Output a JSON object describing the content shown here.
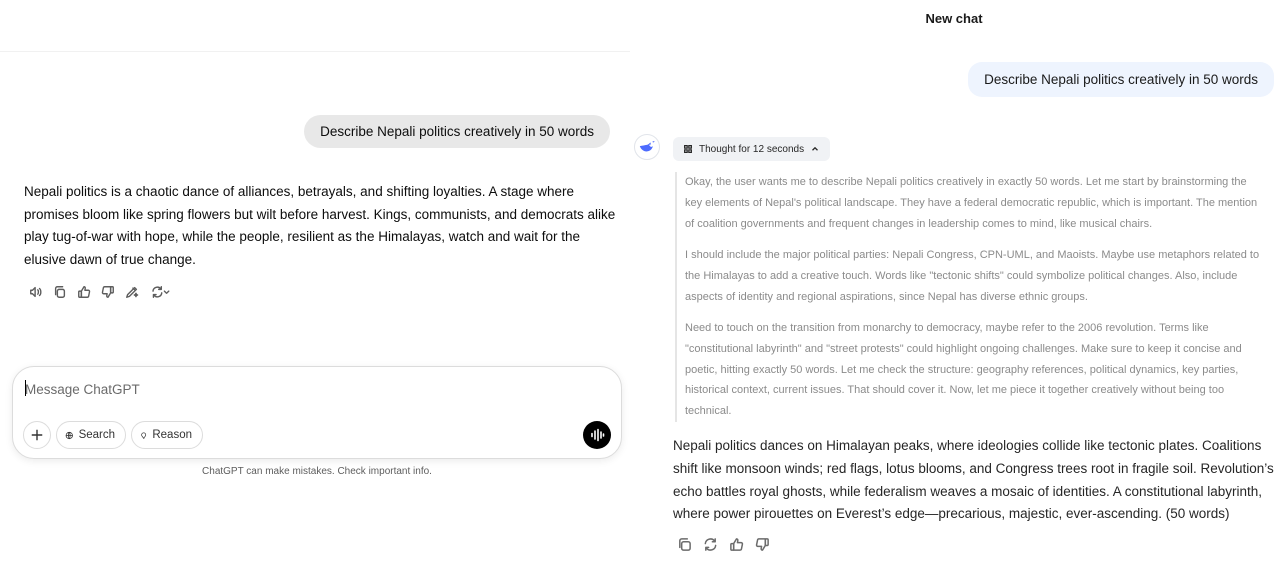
{
  "left": {
    "user_message": "Describe Nepali politics creatively in 50 words",
    "answer": "Nepali politics is a chaotic dance of alliances, betrayals, and shifting loyalties. A stage where promises bloom like spring flowers but wilt before harvest. Kings, communists, and democrats alike play tug-of-war with hope, while the people, resilient as the Himalayas, watch and wait for the elusive dawn of true change.",
    "actions": [
      "read-aloud-icon",
      "copy-icon",
      "thumbs-up-icon",
      "thumbs-down-icon",
      "edit-canvas-icon",
      "regenerate-icon"
    ],
    "composer": {
      "placeholder": "Message ChatGPT",
      "search_label": "Search",
      "reason_label": "Reason"
    },
    "disclaimer": "ChatGPT can make mistakes. Check important info."
  },
  "right": {
    "title": "New chat",
    "user_message": "Describe Nepali politics creatively in 50 words",
    "thought_label": "Thought for 12 seconds",
    "reasoning": [
      "Okay, the user wants me to describe Nepali politics creatively in exactly 50 words. Let me start by brainstorming the key elements of Nepal's political landscape. They have a federal democratic republic, which is important. The mention of coalition governments and frequent changes in leadership comes to mind, like musical chairs.",
      "I should include the major political parties: Nepali Congress, CPN-UML, and Maoists. Maybe use metaphors related to the Himalayas to add a creative touch. Words like \"tectonic shifts\" could symbolize political changes. Also, include aspects of identity and regional aspirations, since Nepal has diverse ethnic groups.",
      "Need to touch on the transition from monarchy to democracy, maybe refer to the 2006 revolution. Terms like \"constitutional labyrinth\" and \"street protests\" could highlight ongoing challenges. Make sure to keep it concise and poetic, hitting exactly 50 words. Let me check the structure: geography references, political dynamics, key parties, historical context, current issues. That should cover it. Now, let me piece it together creatively without being too technical."
    ],
    "answer": "Nepali politics dances on Himalayan peaks, where ideologies collide like tectonic plates. Coalitions shift like monsoon winds; red flags, lotus blooms, and Congress trees root in fragile soil. Revolution’s echo battles royal ghosts, while federalism weaves a mosaic of identities. A constitutional labyrinth, where power pirouettes on Everest’s edge—precarious, majestic, ever-ascending. (50 words)",
    "actions": [
      "copy-icon",
      "regenerate-icon",
      "thumbs-up-icon",
      "thumbs-down-icon"
    ]
  },
  "colors": {
    "user_bubble_left": "#e8e8e8",
    "user_bubble_right": "#eef4fe",
    "ds_brand": "#4d6bfe",
    "reasoning_text": "#8b8b8b"
  }
}
